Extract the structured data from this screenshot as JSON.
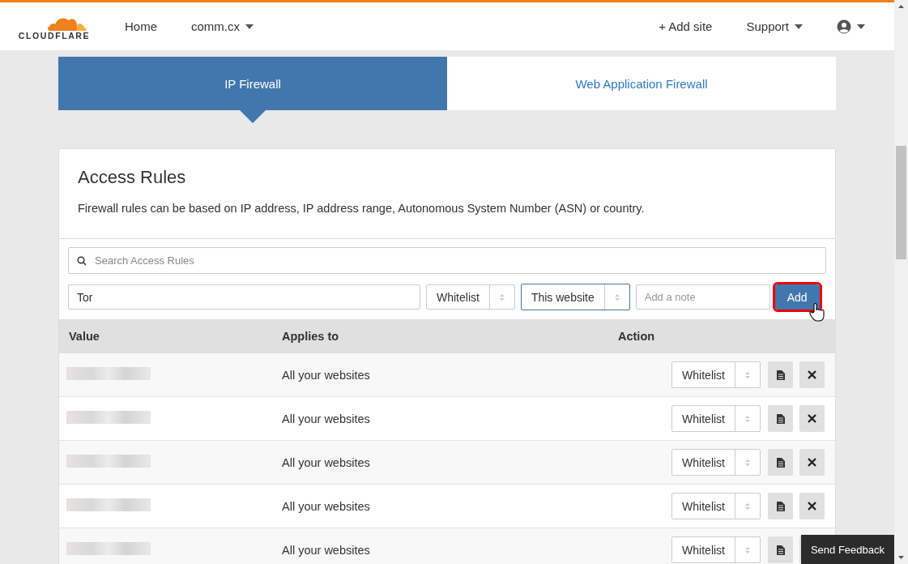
{
  "header": {
    "logo_text": "CLOUDFLARE",
    "nav": [
      {
        "label": "Home",
        "dropdown": false
      },
      {
        "label": "comm.cx",
        "dropdown": true
      }
    ],
    "actions": [
      {
        "kind": "add",
        "label": "+ Add site"
      },
      {
        "kind": "menu",
        "label": "Support"
      },
      {
        "kind": "account"
      }
    ]
  },
  "tabs": [
    {
      "label": "IP Firewall",
      "selected": true
    },
    {
      "label": "Web Application Firewall",
      "selected": false
    }
  ],
  "access_rules": {
    "title": "Access Rules",
    "description": "Firewall rules can be based on IP address, IP address range, Autonomous System Number (ASN) or country.",
    "search": {
      "placeholder": "Search Access Rules"
    },
    "form": {
      "value": "Tor",
      "mode": "Whitelist",
      "scope": "This website",
      "note": {
        "placeholder": "Add a note"
      },
      "add_button": {
        "label": "Add",
        "highlighted": true
      }
    },
    "table": {
      "columns": [
        "Value",
        "Applies to",
        "Action"
      ],
      "rows": [
        {
          "applies_to": "All your websites",
          "action": "Whitelist"
        },
        {
          "applies_to": "All your websites",
          "action": "Whitelist"
        },
        {
          "applies_to": "All your websites",
          "action": "Whitelist"
        },
        {
          "applies_to": "All your websites",
          "action": "Whitelist"
        },
        {
          "applies_to": "All your websites",
          "action": "Whitelist"
        }
      ]
    }
  },
  "feedback_button": "Send Feedback"
}
